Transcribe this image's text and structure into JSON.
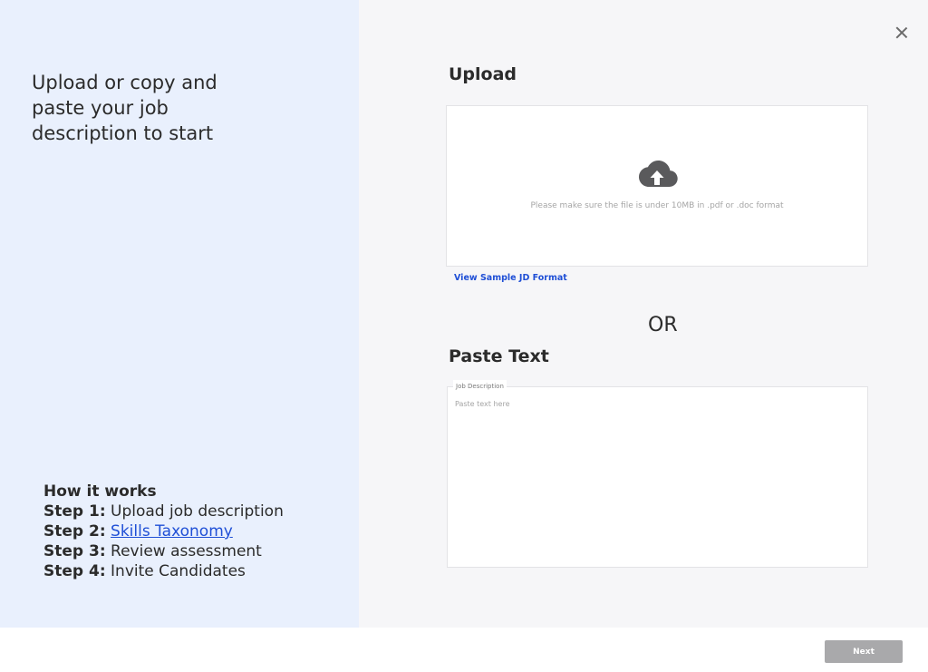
{
  "left": {
    "headline": "Upload or copy and paste your job description to start",
    "how_it_works": {
      "title": "How it works",
      "steps": [
        {
          "label": "Step 1:",
          "text": "Upload job description"
        },
        {
          "label": "Step 2:",
          "text": "Skills Taxonomy"
        },
        {
          "label": "Step 3:",
          "text": "Review assessment"
        },
        {
          "label": "Step 4:",
          "text": "Invite Candidates"
        }
      ]
    }
  },
  "upload": {
    "title": "Upload",
    "icon": "cloud-upload-icon",
    "hint": "Please make sure the file is under 10MB in .pdf or .doc format",
    "sample_link": "View Sample JD Format"
  },
  "divider_text": "OR",
  "paste": {
    "title": "Paste Text",
    "field_label": "Job Description",
    "placeholder": "Paste text here"
  },
  "footer": {
    "next_label": "Next"
  },
  "colors": {
    "left_panel_bg": "#e9f0fd",
    "right_panel_bg": "#f6f6f8",
    "link": "#1f4fd6",
    "next_button_disabled": "#a9a9ab"
  }
}
